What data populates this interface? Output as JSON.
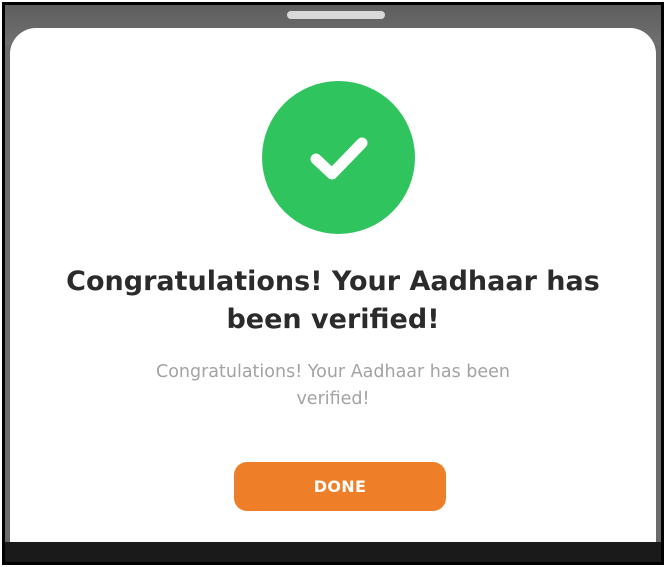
{
  "dialog": {
    "icon": "check-icon",
    "title": "Congratulations! Your Aadhaar has been verified!",
    "message": "Congratulations! Your Aadhaar has been verified!",
    "done_label": "DONE"
  },
  "colors": {
    "success_green": "#2fc45e",
    "accent_orange": "#ee7f28",
    "title_text": "#2b2b2b",
    "message_text": "#a3a3a3",
    "backdrop": "#6b6b6b"
  }
}
